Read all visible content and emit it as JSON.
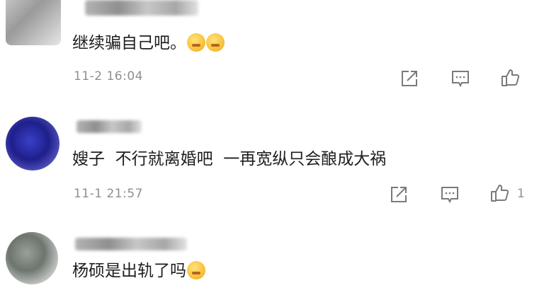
{
  "comments": [
    {
      "text": "继续骗自己吧。",
      "emoji": [
        "shushing-face-emoji",
        "shushing-face-emoji"
      ],
      "time": "11-2 16:04",
      "like_count": ""
    },
    {
      "text": "嫂子  不行就离婚吧  一再宽纵只会酿成大祸",
      "emoji": [],
      "time": "11-1 21:57",
      "like_count": "1"
    },
    {
      "text": "杨硕是出轨了吗",
      "emoji": [
        "crying-face-emoji"
      ],
      "time": "",
      "like_count": ""
    }
  ],
  "icons": {
    "share": "share-icon",
    "reply": "comment-icon",
    "like": "thumbs-up-icon"
  },
  "colors": {
    "text": "#1e1e1e",
    "meta": "#8f8f8f",
    "icon": "#7a7a7a"
  }
}
